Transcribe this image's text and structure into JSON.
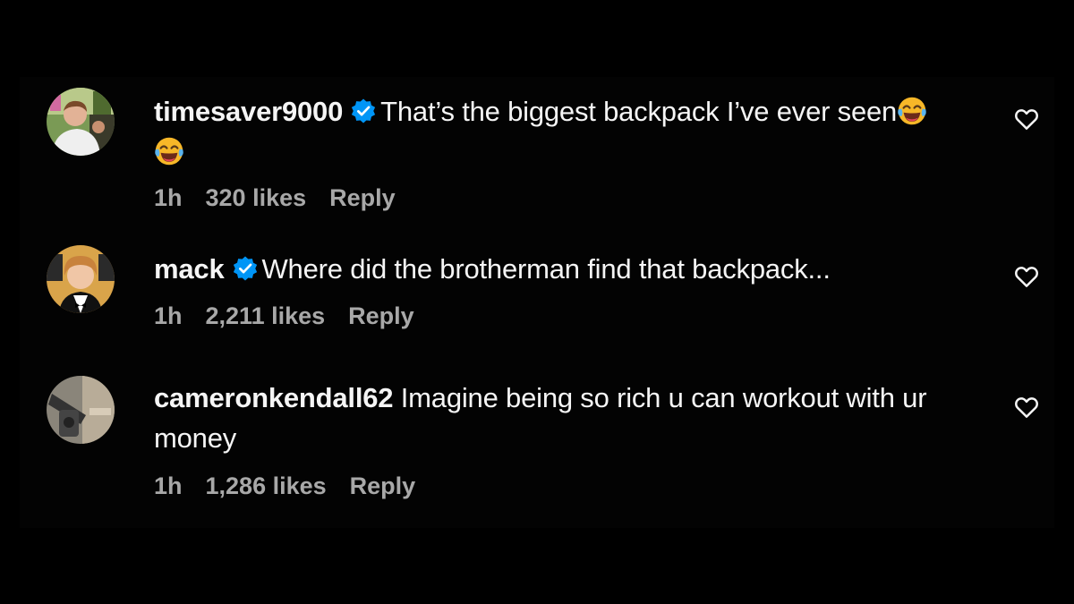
{
  "comments": [
    {
      "username": "timesaver9000",
      "verified": true,
      "text": "That’s the biggest backpack I’ve ever seen",
      "emoji": "face-with-tears-of-joy",
      "time": "1h",
      "likes": "320 likes",
      "reply": "Reply"
    },
    {
      "username": "mack",
      "verified": true,
      "text": "Where did the brotherman find that backpack...",
      "time": "1h",
      "likes": "2,211 likes",
      "reply": "Reply"
    },
    {
      "username": "cameronkendall62",
      "verified": false,
      "text": "Imagine being so rich u can workout with ur money",
      "time": "1h",
      "likes": "1,286 likes",
      "reply": "Reply"
    }
  ],
  "icons": {
    "verified": "verified-badge-icon",
    "like": "heart-outline-icon"
  },
  "colors": {
    "background": "#000000",
    "text": "#f5f5f5",
    "meta": "#a8a8a8",
    "verified": "#0095f6"
  }
}
